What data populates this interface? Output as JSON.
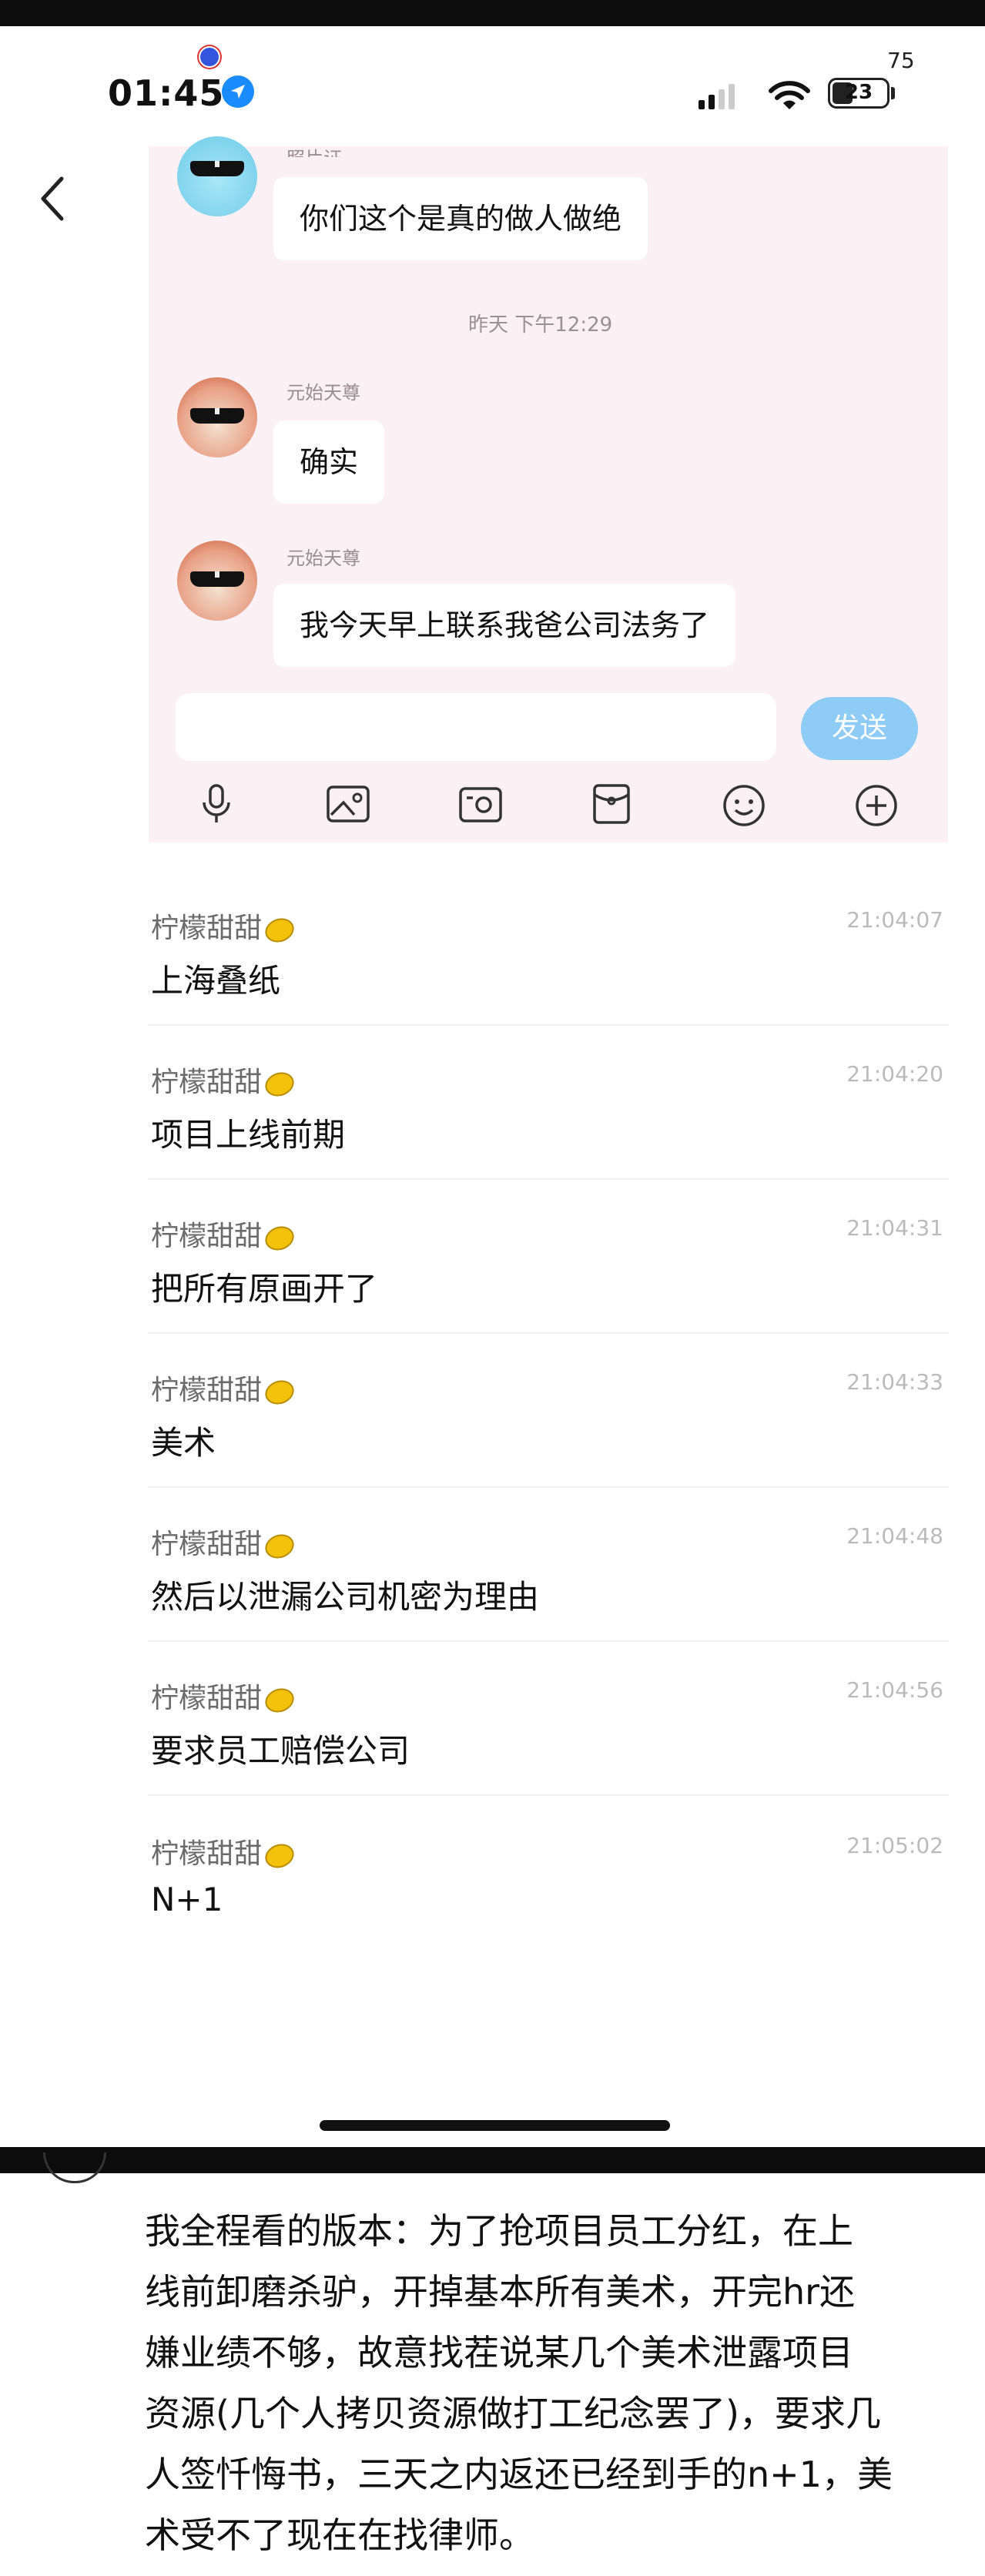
{
  "status_bar": {
    "time": "01:45",
    "battery": "23",
    "counter": "75"
  },
  "chat": {
    "partial_sender": "照片证",
    "partial_message": "你们这个是真的做人做绝",
    "timestamp": "昨天 下午12:29",
    "messages": [
      {
        "sender": "元始天尊",
        "text": "确实"
      },
      {
        "sender": "元始天尊",
        "text": "我今天早上联系我爸公司法务了"
      }
    ],
    "send_label": "发送",
    "toolbar_icons": [
      "microphone-icon",
      "image-icon",
      "camera-icon",
      "red-packet-icon",
      "emoji-icon",
      "plus-icon"
    ]
  },
  "feed": {
    "items": [
      {
        "name": "柠檬甜甜",
        "time": "21:04:07",
        "text": "上海叠纸"
      },
      {
        "name": "柠檬甜甜",
        "time": "21:04:20",
        "text": "项目上线前期"
      },
      {
        "name": "柠檬甜甜",
        "time": "21:04:31",
        "text": "把所有原画开了"
      },
      {
        "name": "柠檬甜甜",
        "time": "21:04:33",
        "text": "美术"
      },
      {
        "name": "柠檬甜甜",
        "time": "21:04:48",
        "text": "然后以泄漏公司机密为理由"
      },
      {
        "name": "柠檬甜甜",
        "time": "21:04:56",
        "text": "要求员工赔偿公司"
      },
      {
        "name": "柠檬甜甜",
        "time": "21:05:02",
        "text": "N+1"
      }
    ]
  },
  "comment": {
    "lines": [
      "我全程看的版本：为了抢项目员工分红，在上",
      "线前卸磨杀驴，开掉基本所有美术，开完hr还",
      "嫌业绩不够，故意找茬说某几个美术泄露项目",
      "资源(几个人拷贝资源做打工纪念罢了)，要求几",
      "人签忏悔书，三天之内返还已经到手的n+1，美",
      "术受不了现在在找律师。"
    ]
  },
  "colors": {
    "pink_bg": "#fbf0f3",
    "send_button": "#8ecbf5",
    "location_icon": "#1a8cff",
    "lemon": "#f4c20d"
  }
}
